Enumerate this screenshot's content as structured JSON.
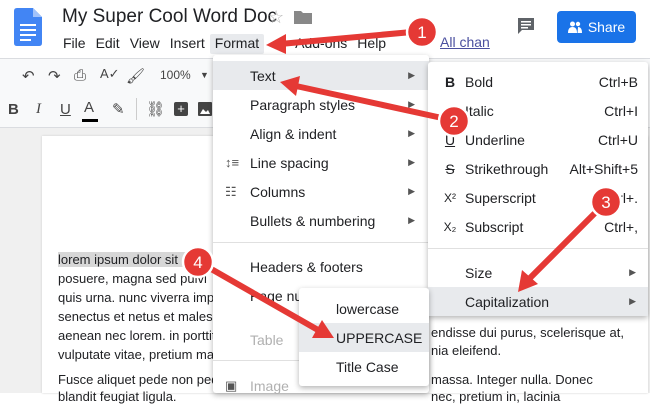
{
  "header": {
    "title": "My Super Cool Word Doc",
    "last_edit": "All chan",
    "share_label": "Share"
  },
  "menubar": {
    "items": [
      "File",
      "Edit",
      "View",
      "Insert",
      "Format",
      "Add-ons",
      "Help"
    ]
  },
  "toolbar": {
    "zoom": "100%"
  },
  "document": {
    "lines": [
      "lorem ipsum dolor sit am",
      "posuere, magna sed pulvi",
      "quis urna. nunc viverra impe",
      "senectus et netus et malesua",
      "aenean nec lorem. in porttito",
      "vulputate vitae, pretium matt",
      "Fusce aliquet pede non pede",
      "blandit feugiat ligula."
    ],
    "right_lines": [
      "endisse dui purus, scelerisque at,",
      "nia eleifend.",
      "massa. Integer nulla. Donec",
      "nec, pretium in, lacinia"
    ]
  },
  "format_menu": {
    "items": [
      {
        "label": "Text",
        "has_submenu": true
      },
      {
        "label": "Paragraph styles",
        "has_submenu": true
      },
      {
        "label": "Align & indent",
        "has_submenu": true
      },
      {
        "label": "Line spacing",
        "has_submenu": true
      },
      {
        "label": "Columns",
        "has_submenu": true
      },
      {
        "label": "Bullets & numbering",
        "has_submenu": true
      },
      {
        "label": "Headers & footers",
        "has_submenu": false
      },
      {
        "label": "Page numbers",
        "has_submenu": false
      },
      {
        "label": "Table",
        "has_submenu": true
      },
      {
        "label": "Image",
        "has_submenu": true
      }
    ]
  },
  "text_menu": {
    "items": [
      {
        "label": "Bold",
        "shortcut": "Ctrl+B",
        "icon_label": "B"
      },
      {
        "label": "Italic",
        "shortcut": "Ctrl+I",
        "icon_label": "I"
      },
      {
        "label": "Underline",
        "shortcut": "Ctrl+U",
        "icon_label": "U"
      },
      {
        "label": "Strikethrough",
        "shortcut": "Alt+Shift+5",
        "icon_label": "S"
      },
      {
        "label": "Superscript",
        "shortcut": "Ctrl+.",
        "icon_label": "X²"
      },
      {
        "label": "Subscript",
        "shortcut": "Ctrl+,",
        "icon_label": "X₂"
      },
      {
        "label": "Size",
        "shortcut": ""
      },
      {
        "label": "Capitalization",
        "shortcut": ""
      }
    ]
  },
  "caps_menu": {
    "items": [
      "lowercase",
      "UPPERCASE",
      "Title Case"
    ]
  },
  "annotations": {
    "labels": [
      "1",
      "2",
      "3",
      "4"
    ],
    "color": "#e53935"
  },
  "colors": {
    "accent": "#1a73e8",
    "arrow": "#e53935"
  }
}
